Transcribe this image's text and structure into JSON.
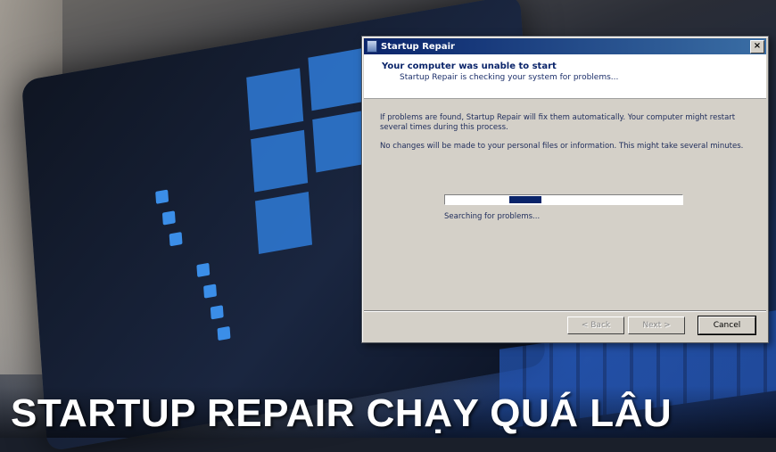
{
  "dialog": {
    "title": "Startup Repair",
    "close_label": "×",
    "header_title": "Your computer was unable to start",
    "header_subtitle": "Startup Repair is checking your system for problems...",
    "paragraph1": "If problems are found, Startup Repair will fix them automatically. Your computer might restart several times during this process.",
    "paragraph2": "No changes will be made to your personal files or information. This might take several minutes.",
    "progress_status": "Searching for problems...",
    "buttons": {
      "back": "< Back",
      "next": "Next >",
      "cancel": "Cancel"
    }
  },
  "caption": "STARTUP REPAIR CHẠY QUÁ LÂU",
  "colors": {
    "titlebar": "#0a246a",
    "dialog_bg": "#d4d0c8",
    "caption_text": "#ffffff"
  }
}
